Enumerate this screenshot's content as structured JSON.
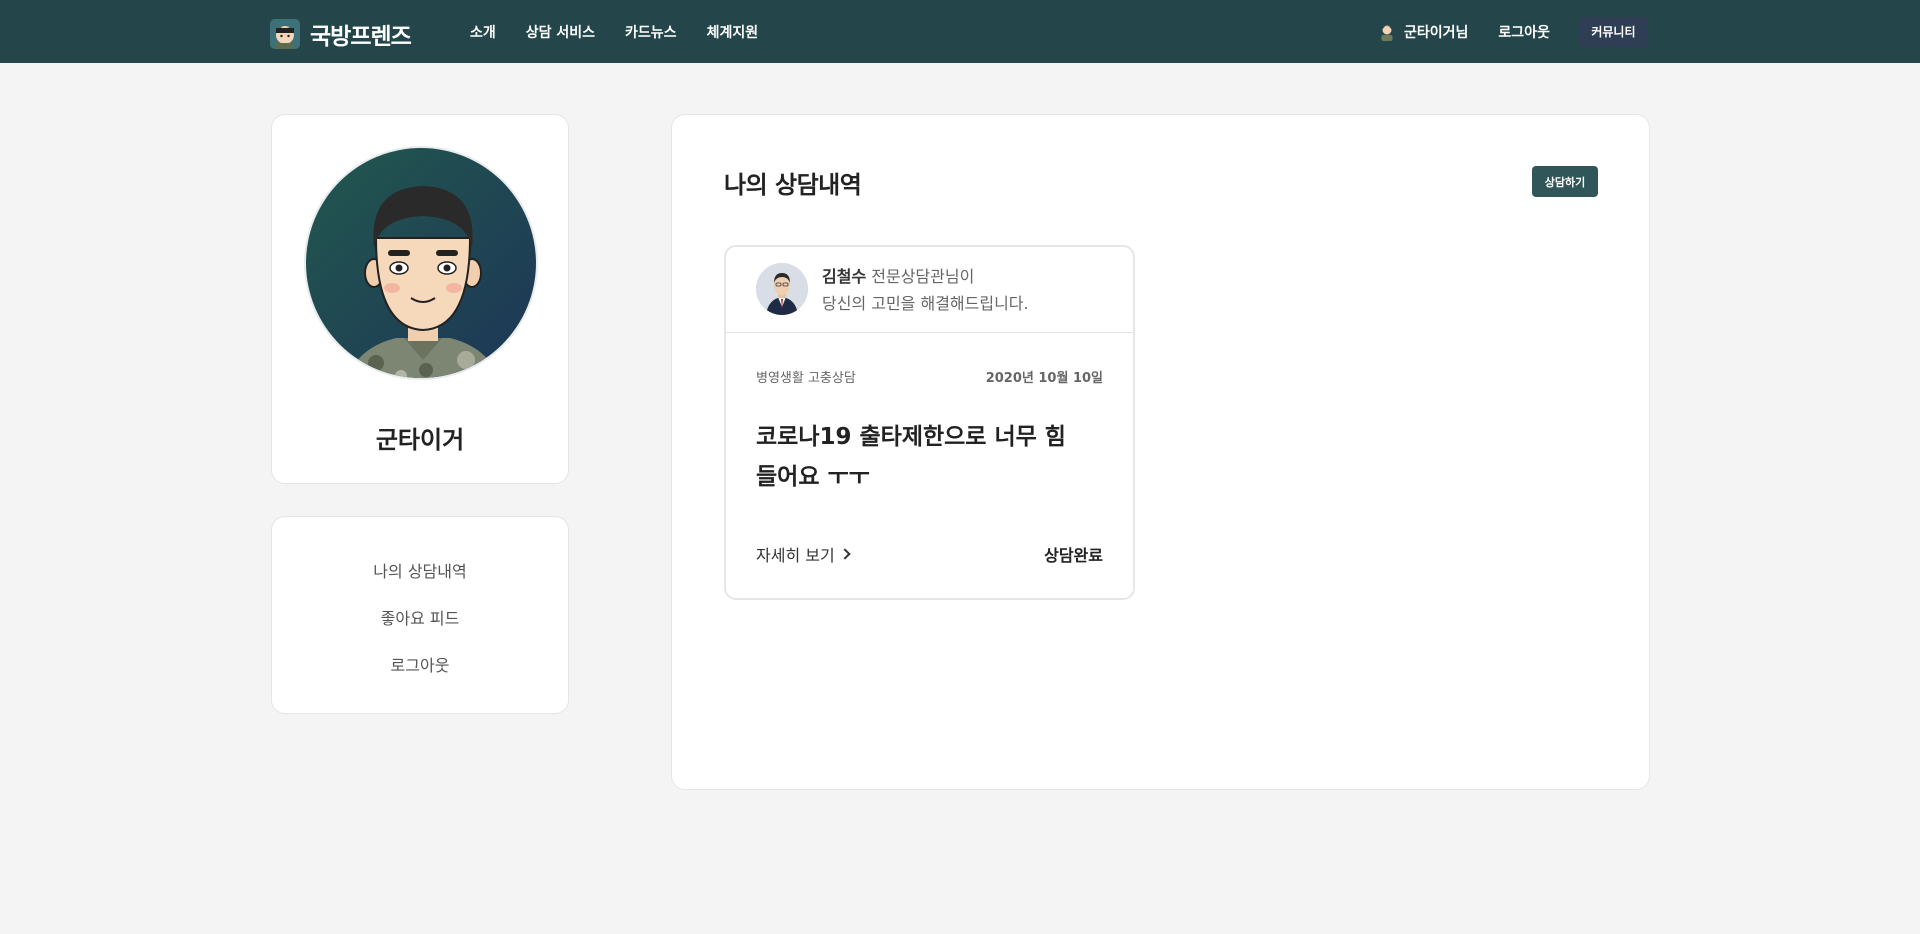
{
  "header": {
    "logo_text": "국방프렌즈",
    "nav": [
      "소개",
      "상담 서비스",
      "카드뉴스",
      "체계지원"
    ],
    "user_name": "군타이거님",
    "logout_label": "로그아웃",
    "community_label": "커뮤니티"
  },
  "profile": {
    "name": "군타이거"
  },
  "side_menu": {
    "items": [
      "나의 상담내역",
      "좋아요 피드",
      "로그아웃"
    ]
  },
  "main": {
    "title": "나의 상담내역",
    "consult_button": "상담하기",
    "items": [
      {
        "counselor_name": "김철수",
        "counselor_role": "전문상담관님이",
        "counselor_message": "당신의 고민을 해결해드립니다.",
        "category": "병영생활 고충상담",
        "date": "2020년 10월 10일",
        "title": "코로나19 출타제한으로 너무 힘들어요 ㅜㅜ",
        "detail_label": "자세히 보기",
        "status": "상담완료"
      }
    ]
  },
  "colors": {
    "header_bg": "#24464a",
    "accent": "#30565a",
    "community_bg": "#2f3e55"
  }
}
